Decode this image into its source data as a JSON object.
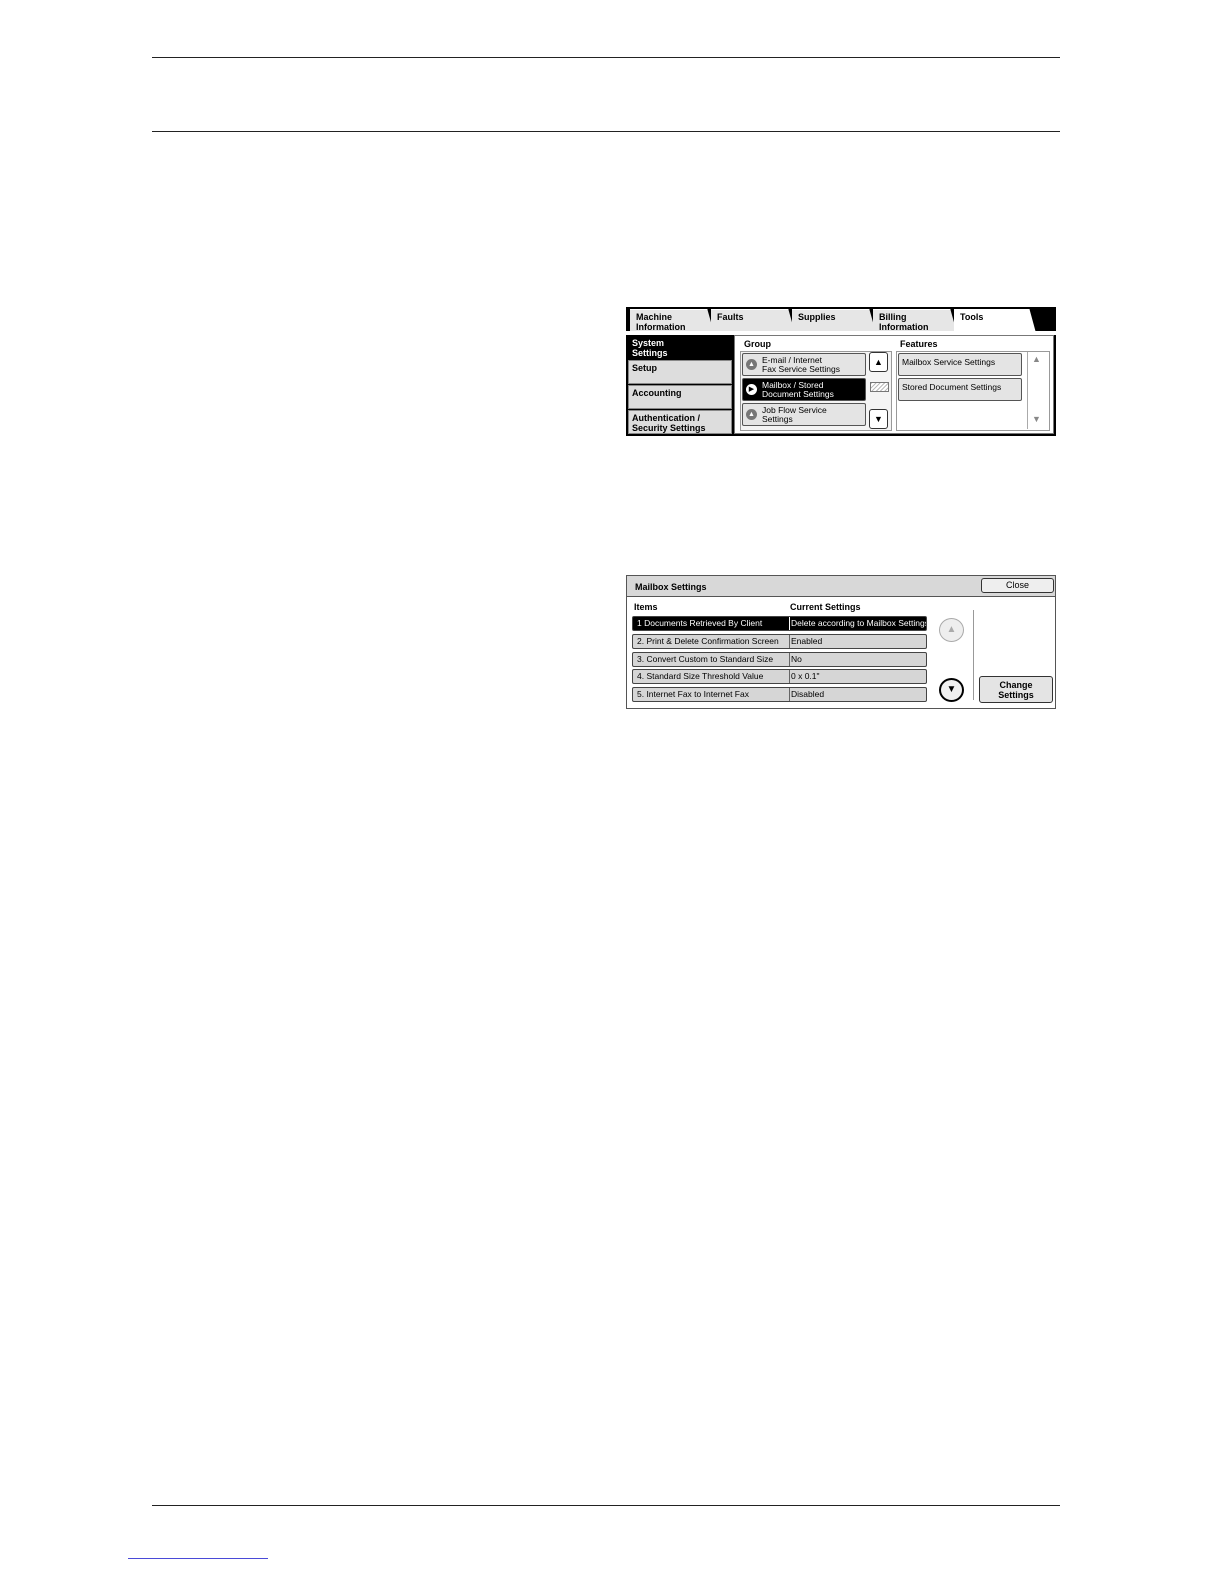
{
  "tools_screen": {
    "tabs": [
      {
        "label": "Machine\nInformation"
      },
      {
        "label": "Faults"
      },
      {
        "label": "Supplies"
      },
      {
        "label": "Billing\nInformation"
      },
      {
        "label": "Tools"
      }
    ],
    "sidebar": [
      {
        "label": "System\nSettings"
      },
      {
        "label": "Setup"
      },
      {
        "label": "Accounting"
      },
      {
        "label": "Authentication /\nSecurity Settings"
      }
    ],
    "group_header": "Group",
    "groups": [
      {
        "label": "E-mail / Internet\nFax Service Settings"
      },
      {
        "label": "Mailbox / Stored\nDocument Settings"
      },
      {
        "label": "Job Flow Service\nSettings"
      }
    ],
    "features_header": "Features",
    "features": [
      {
        "label": "Mailbox Service Settings"
      },
      {
        "label": "Stored Document Settings"
      }
    ]
  },
  "mailbox_screen": {
    "title": "Mailbox Settings",
    "close_label": "Close",
    "items_header": "Items",
    "current_header": "Current Settings",
    "rows": [
      {
        "item": "1 Documents Retrieved By Client",
        "value": "Delete according to Mailbox Settings"
      },
      {
        "item": "2. Print & Delete Confirmation Screen",
        "value": "Enabled"
      },
      {
        "item": "3. Convert Custom to Standard Size",
        "value": "No"
      },
      {
        "item": "4. Standard Size Threshold Value",
        "value": "0 x 0.1\""
      },
      {
        "item": "5. Internet Fax to Internet Fax",
        "value": "Disabled"
      }
    ],
    "change_label": "Change\nSettings"
  }
}
